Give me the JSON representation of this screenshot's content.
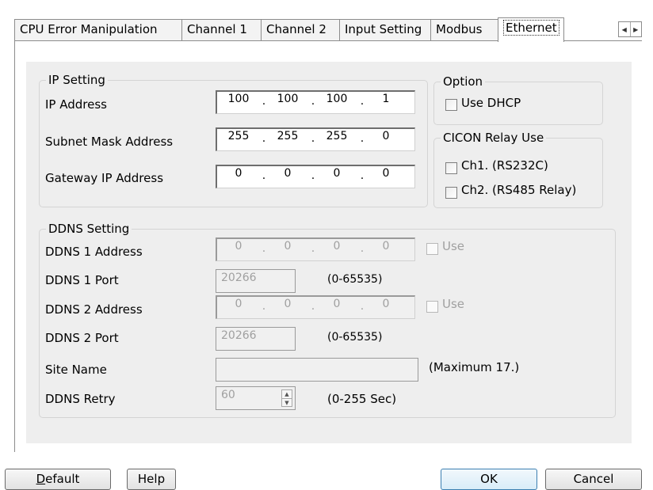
{
  "tabs": [
    {
      "label": "CPU Error Manipulation"
    },
    {
      "label": "Channel 1"
    },
    {
      "label": "Channel 2"
    },
    {
      "label": "Input Setting"
    },
    {
      "label": "Modbus"
    },
    {
      "label": "Ethernet",
      "active": true
    }
  ],
  "ip_setting": {
    "legend": "IP Setting",
    "ip_address": {
      "label": "IP Address",
      "octets": [
        "100",
        "100",
        "100",
        "1"
      ]
    },
    "subnet_mask": {
      "label": "Subnet Mask Address",
      "octets": [
        "255",
        "255",
        "255",
        "0"
      ]
    },
    "gateway": {
      "label": "Gateway IP Address",
      "octets": [
        "0",
        "0",
        "0",
        "0"
      ]
    }
  },
  "option": {
    "legend": "Option",
    "use_dhcp": {
      "label": "Use DHCP",
      "checked": false
    }
  },
  "cicon_relay": {
    "legend": "CICON Relay Use",
    "ch1": {
      "label": "Ch1. (RS232C)",
      "checked": false
    },
    "ch2": {
      "label": "Ch2. (RS485 Relay)",
      "checked": false
    }
  },
  "ddns_setting": {
    "legend": "DDNS Setting",
    "ddns1_address": {
      "label": "DDNS 1 Address",
      "octets": [
        "0",
        "0",
        "0",
        "0"
      ],
      "use_label": "Use"
    },
    "ddns1_port": {
      "label": "DDNS 1 Port",
      "value": "20266",
      "range": "(0-65535)"
    },
    "ddns2_address": {
      "label": "DDNS 2 Address",
      "octets": [
        "0",
        "0",
        "0",
        "0"
      ],
      "use_label": "Use"
    },
    "ddns2_port": {
      "label": "DDNS 2 Port",
      "value": "20266",
      "range": "(0-65535)"
    },
    "site_name": {
      "label": "Site Name",
      "value": "",
      "hint": "(Maximum 17.)"
    },
    "ddns_retry": {
      "label": "DDNS Retry",
      "value": "60",
      "range": "(0-255 Sec)"
    }
  },
  "buttons": {
    "default_first": "D",
    "default_rest": "efault",
    "help": "Help",
    "ok": "OK",
    "cancel": "Cancel"
  },
  "icons": {
    "tab_scroll_left": "triangle-left-icon",
    "tab_scroll_right": "triangle-right-icon",
    "spin_up": "triangle-up-icon",
    "spin_down": "triangle-down-icon"
  },
  "colors": {
    "panel_bg": "#eeeeee",
    "default_button_border": "#3c7fb1"
  }
}
